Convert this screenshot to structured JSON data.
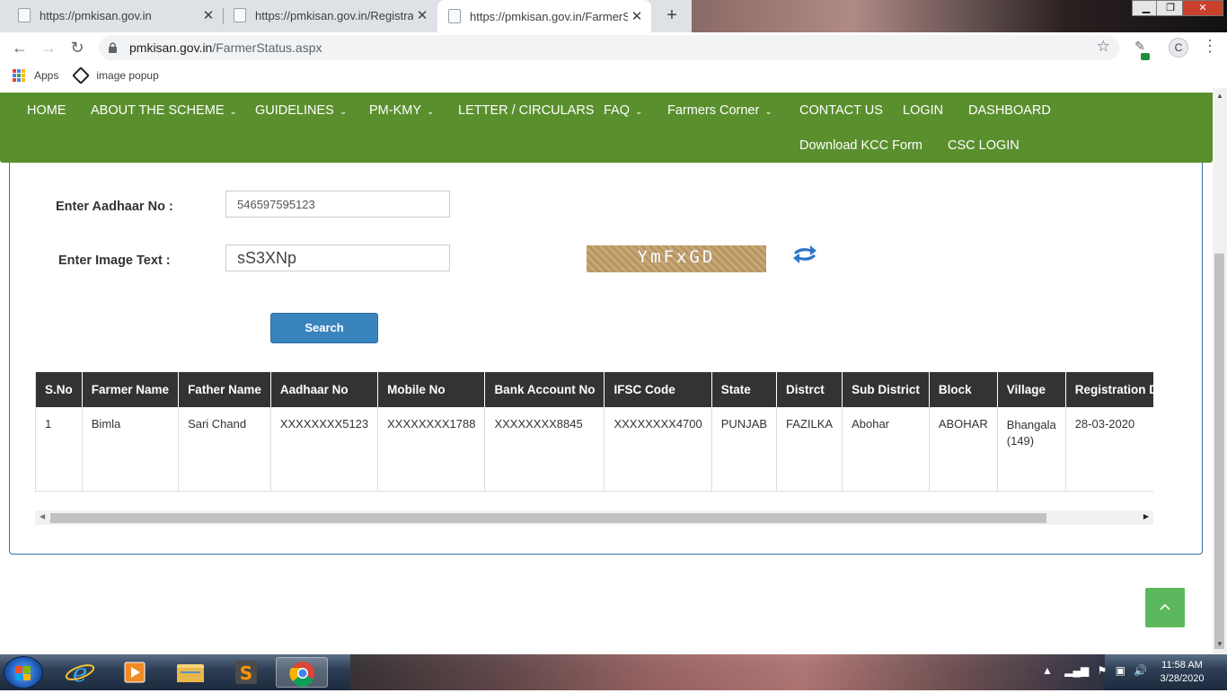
{
  "browser": {
    "tabs": [
      {
        "title": "https://pmkisan.gov.in",
        "active": false
      },
      {
        "title": "https://pmkisan.gov.in/Registrati",
        "active": false
      },
      {
        "title": "https://pmkisan.gov.in/FarmerSta",
        "active": true
      }
    ],
    "url_host": "pmkisan.gov.in",
    "url_path": "/FarmerStatus.aspx",
    "profile_initial": "C",
    "bookmarks": [
      {
        "label": "Apps",
        "icon": "apps-grid-icon"
      },
      {
        "label": "image popup",
        "icon": "codepen-icon"
      }
    ]
  },
  "nav": {
    "items": [
      {
        "label": "HOME",
        "dropdown": false
      },
      {
        "label": "ABOUT THE SCHEME",
        "dropdown": true
      },
      {
        "label": "GUIDELINES",
        "dropdown": true
      },
      {
        "label": "PM-KMY",
        "dropdown": true
      },
      {
        "label": "LETTER / CIRCULARS",
        "dropdown": false
      },
      {
        "label": "FAQ",
        "dropdown": true
      },
      {
        "label": "Farmers Corner",
        "dropdown": true
      },
      {
        "label": "CONTACT US",
        "dropdown": false
      },
      {
        "label": "LOGIN",
        "dropdown": false
      },
      {
        "label": "DASHBOARD",
        "dropdown": false
      },
      {
        "label": "Download KCC Form",
        "dropdown": false
      },
      {
        "label": "CSC LOGIN",
        "dropdown": false
      }
    ],
    "color": "#5a8f2e"
  },
  "form": {
    "aadhaar_label": "Enter Aadhaar No :",
    "aadhaar_value": "546597595123",
    "image_text_label": "Enter Image Text :",
    "image_text_value": "sS3XNp",
    "captcha_text": "YmFxGD",
    "search_label": "Search"
  },
  "table": {
    "columns": [
      "S.No",
      "Farmer Name",
      "Father Name",
      "Aadhaar No",
      "Mobile No",
      "Bank Account No",
      "IFSC Code",
      "State",
      "Distrct",
      "Sub District",
      "Block",
      "Village",
      "Registration Date"
    ],
    "rows": [
      [
        "1",
        "Bimla",
        "Sari Chand",
        "XXXXXXXX5123",
        "XXXXXXXX1788",
        "XXXXXXXX8845",
        "XXXXXXXX4700",
        "PUNJAB",
        "FAZILKA",
        "Abohar",
        "ABOHAR",
        "Bhangala (149)",
        "28-03-2020"
      ]
    ]
  },
  "taskbar": {
    "time": "11:58 AM",
    "date": "3/28/2020",
    "apps": [
      "internet-explorer-icon",
      "media-player-icon",
      "file-explorer-icon",
      "sublime-text-icon",
      "chrome-icon"
    ]
  }
}
